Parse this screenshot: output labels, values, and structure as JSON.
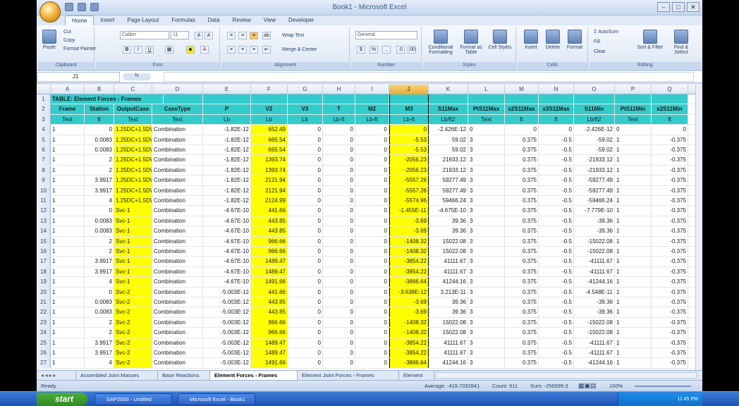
{
  "window": {
    "title": "Book1 - Microsoft Excel",
    "office_button": "",
    "minimize": "–",
    "maximize": "□",
    "close": "✕"
  },
  "tabs": [
    "Home",
    "Insert",
    "Page Layout",
    "Formulas",
    "Data",
    "Review",
    "View",
    "Developer"
  ],
  "active_tab": "Home",
  "ribbon": {
    "clipboard": {
      "label": "Clipboard",
      "paste": "Paste",
      "cut": "Cut",
      "copy": "Copy",
      "format_painter": "Format Painter"
    },
    "font": {
      "label": "Font",
      "font_name": "Calibri",
      "font_size": "11",
      "bold": "B",
      "italic": "I",
      "underline": "U"
    },
    "alignment": {
      "label": "Alignment",
      "wrap": "Wrap Text",
      "merge": "Merge & Center"
    },
    "number": {
      "label": "Number",
      "format": "General",
      "currency": "$",
      "percent": "%",
      "comma": ","
    },
    "styles": {
      "label": "Styles",
      "conditional": "Conditional Formatting",
      "format_table": "Format as Table",
      "cell_styles": "Cell Styles"
    },
    "cells": {
      "label": "Cells",
      "insert": "Insert",
      "delete": "Delete",
      "format": "Format"
    },
    "editing": {
      "label": "Editing",
      "autosum": "AutoSum",
      "fill": "Fill",
      "clear": "Clear",
      "sort": "Sort & Filter",
      "find": "Find & Select"
    }
  },
  "formula_bar": {
    "name_box": "J1",
    "fx": "fx",
    "content": ""
  },
  "columns": [
    "A",
    "B",
    "C",
    "D",
    "E",
    "F",
    "G",
    "H",
    "I",
    "J",
    "K",
    "L",
    "M",
    "N",
    "O",
    "P",
    "Q"
  ],
  "selected_column": "J",
  "table_title": "TABLE:  Element Forces - Frames",
  "headers": [
    "Frame",
    "Station",
    "OutputCase",
    "CaseType",
    "P",
    "V2",
    "V3",
    "T",
    "M2",
    "M3",
    "S11Max",
    "PtS11Max",
    "x2S11Max",
    "x3S11Max",
    "S11Min",
    "PtS11Min",
    "x2S11Min"
  ],
  "units": [
    "Text",
    "ft",
    "Text",
    "Text",
    "Lb",
    "Lb",
    "Lb",
    "Lb-ft",
    "Lb-ft",
    "Lb-ft",
    "Lb/ft2",
    "Text",
    "ft",
    "ft",
    "Lb/ft2",
    "Text",
    "ft"
  ],
  "row_numbers": [
    "1",
    "2",
    "3",
    "4",
    "5",
    "6",
    "7",
    "8",
    "9",
    "10",
    "11",
    "12",
    "13",
    "14",
    "15",
    "16",
    "17",
    "18",
    "19",
    "20",
    "21",
    "22",
    "23",
    "24",
    "25",
    "26",
    "27"
  ],
  "rows": [
    [
      "1",
      "0",
      "1.25DC+1.5DW",
      "Combination",
      "-1.82E-12",
      "652.49",
      "0",
      "0",
      "0",
      "0",
      "-2.426E-12",
      "0",
      "0",
      "0",
      "-2.426E-12",
      "0",
      "0"
    ],
    [
      "1",
      "0.0083",
      "1.25DC+1.5DW",
      "Combination",
      "-1.82E-12",
      "665.54",
      "0",
      "0",
      "0",
      "-5.53",
      "59.02",
      "3",
      "0.375",
      "-0.5",
      "-59.02",
      "1",
      "-0.375"
    ],
    [
      "1",
      "0.0083",
      "1.25DC+1.5DW",
      "Combination",
      "-1.82E-12",
      "665.54",
      "0",
      "0",
      "0",
      "-5.53",
      "59.02",
      "3",
      "0.375",
      "-0.5",
      "-59.02",
      "1",
      "-0.375"
    ],
    [
      "1",
      "2",
      "1.25DC+1.5DW",
      "Combination",
      "-1.82E-12",
      "1393.74",
      "0",
      "0",
      "0",
      "-2056.23",
      "21933.12",
      "3",
      "0.375",
      "-0.5",
      "-21933.12",
      "1",
      "-0.375"
    ],
    [
      "1",
      "2",
      "1.25DC+1.5DW",
      "Combination",
      "-1.82E-12",
      "1393.74",
      "0",
      "0",
      "0",
      "-2056.23",
      "21933.12",
      "3",
      "0.375",
      "-0.5",
      "-21933.12",
      "1",
      "-0.375"
    ],
    [
      "1",
      "3.9917",
      "1.25DC+1.5DW",
      "Combination",
      "-1.82E-12",
      "2121.94",
      "0",
      "0",
      "0",
      "-5557.26",
      "59277.49",
      "3",
      "0.375",
      "-0.5",
      "-59277.49",
      "1",
      "-0.375"
    ],
    [
      "1",
      "3.9917",
      "1.25DC+1.5DW",
      "Combination",
      "-1.82E-12",
      "2121.94",
      "0",
      "0",
      "0",
      "-5557.26",
      "59277.49",
      "3",
      "0.375",
      "-0.5",
      "-59277.49",
      "1",
      "-0.375"
    ],
    [
      "1",
      "4",
      "1.25DC+1.5DW",
      "Combination",
      "-1.82E-12",
      "2124.99",
      "0",
      "0",
      "0",
      "-5574.96",
      "59466.24",
      "3",
      "0.375",
      "-0.5",
      "-59466.24",
      "1",
      "-0.375"
    ],
    [
      "1",
      "0",
      "Svc-1",
      "Combination",
      "-4.67E-10",
      "441.66",
      "0",
      "0",
      "0",
      "-1.455E-11",
      "-4.675E-10",
      "3",
      "0.375",
      "-0.5",
      "-7.779E-10",
      "1",
      "-0.375"
    ],
    [
      "1",
      "0.0083",
      "Svc-1",
      "Combination",
      "-4.67E-10",
      "443.85",
      "0",
      "0",
      "0",
      "-3.69",
      "39.36",
      "3",
      "0.375",
      "-0.5",
      "-39.36",
      "1",
      "-0.375"
    ],
    [
      "1",
      "0.0083",
      "Svc-1",
      "Combination",
      "-4.67E-10",
      "443.85",
      "0",
      "0",
      "0",
      "-3.69",
      "39.36",
      "3",
      "0.375",
      "-0.5",
      "-39.36",
      "1",
      "-0.375"
    ],
    [
      "1",
      "2",
      "Svc-1",
      "Combination",
      "-4.67E-10",
      "966.66",
      "0",
      "0",
      "0",
      "-1408.32",
      "15022.08",
      "3",
      "0.375",
      "-0.5",
      "-15022.08",
      "1",
      "-0.375"
    ],
    [
      "1",
      "2",
      "Svc-1",
      "Combination",
      "-4.67E-10",
      "966.66",
      "0",
      "0",
      "0",
      "-1408.32",
      "15022.08",
      "3",
      "0.375",
      "-0.5",
      "-15022.08",
      "1",
      "-0.375"
    ],
    [
      "1",
      "3.9917",
      "Svc-1",
      "Combination",
      "-4.67E-10",
      "1489.47",
      "0",
      "0",
      "0",
      "-3854.22",
      "41111.67",
      "3",
      "0.375",
      "-0.5",
      "-41111.67",
      "1",
      "-0.375"
    ],
    [
      "1",
      "3.9917",
      "Svc-1",
      "Combination",
      "-4.67E-10",
      "1489.47",
      "0",
      "0",
      "0",
      "-3854.22",
      "41111.67",
      "3",
      "0.375",
      "-0.5",
      "-41111.67",
      "1",
      "-0.375"
    ],
    [
      "1",
      "4",
      "Svc-1",
      "Combination",
      "-4.67E-10",
      "1491.66",
      "0",
      "0",
      "0",
      "-3866.64",
      "41244.16",
      "3",
      "0.375",
      "-0.5",
      "-41244.16",
      "1",
      "-0.375"
    ],
    [
      "1",
      "0",
      "Svc-2",
      "Combination",
      "-5.003E-12",
      "441.66",
      "0",
      "0",
      "0",
      "-3.638E-12",
      "3.213E-11",
      "3",
      "0.375",
      "-0.5",
      "-4.548E-11",
      "1",
      "-0.375"
    ],
    [
      "1",
      "0.0083",
      "Svc-2",
      "Combination",
      "-5.003E-12",
      "443.85",
      "0",
      "0",
      "0",
      "-3.69",
      "39.36",
      "3",
      "0.375",
      "-0.5",
      "-39.36",
      "1",
      "-0.375"
    ],
    [
      "1",
      "0.0083",
      "Svc-2",
      "Combination",
      "-5.003E-12",
      "443.85",
      "0",
      "0",
      "0",
      "-3.69",
      "39.36",
      "3",
      "0.375",
      "-0.5",
      "-39.36",
      "1",
      "-0.375"
    ],
    [
      "1",
      "2",
      "Svc-2",
      "Combination",
      "-5.003E-12",
      "966.66",
      "0",
      "0",
      "0",
      "-1408.32",
      "15022.08",
      "3",
      "0.375",
      "-0.5",
      "-15022.08",
      "1",
      "-0.375"
    ],
    [
      "1",
      "2",
      "Svc-2",
      "Combination",
      "-5.003E-12",
      "966.66",
      "0",
      "0",
      "0",
      "-1408.32",
      "15022.08",
      "3",
      "0.375",
      "-0.5",
      "-15022.08",
      "1",
      "-0.375"
    ],
    [
      "1",
      "3.9917",
      "Svc-2",
      "Combination",
      "-5.003E-12",
      "1489.47",
      "0",
      "0",
      "0",
      "-3854.22",
      "41111.67",
      "3",
      "0.375",
      "-0.5",
      "-41111.67",
      "1",
      "-0.375"
    ],
    [
      "1",
      "3.9917",
      "Svc-2",
      "Combination",
      "-5.003E-12",
      "1489.47",
      "0",
      "0",
      "0",
      "-3854.22",
      "41111.67",
      "3",
      "0.375",
      "-0.5",
      "-41111.67",
      "1",
      "-0.375"
    ],
    [
      "1",
      "4",
      "Svc-2",
      "Combination",
      "-5.003E-12",
      "1491.66",
      "0",
      "0",
      "0",
      "-3866.64",
      "41244.16",
      "3",
      "0.375",
      "-0.5",
      "-41244.16",
      "1",
      "-0.375"
    ]
  ],
  "sheet_tabs": [
    "Assembled Joint Masses",
    "Base Reactions",
    "Element Forces - Frames",
    "Element Joint Forces - Frames",
    "Element"
  ],
  "active_sheet": "Element Forces - Frames",
  "status": {
    "ready": "Ready",
    "average": "Average: -419.7032841",
    "count": "Count: 611",
    "sum": "Sum: -256599.3",
    "zoom": "100%"
  },
  "taskbar": {
    "start": "start",
    "items": [
      "SAP2000 - Untitled",
      "Microsoft Excel - Book1"
    ],
    "clock": "11:45 PM"
  },
  "colors": {
    "highlight": "#ffff00",
    "title_fill": "#33cccc",
    "ribbon": "#dfe8f5",
    "taskbar": "#2a62c8"
  }
}
